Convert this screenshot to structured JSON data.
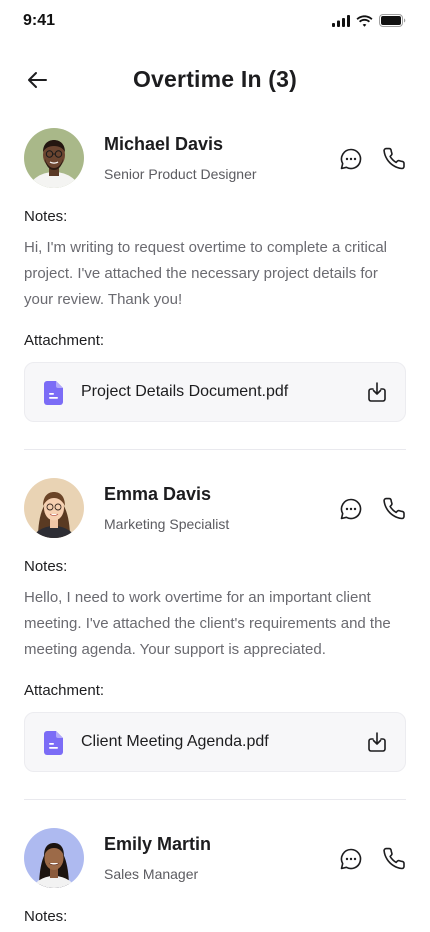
{
  "status_bar": {
    "time": "9:41"
  },
  "header": {
    "title": "Overtime In (3)"
  },
  "requests": [
    {
      "name": "Michael Davis",
      "role": "Senior Product Designer",
      "notes_label": "Notes:",
      "notes": "Hi, I'm writing to request overtime to complete a critical project. I've attached the necessary project details for your review. Thank you!",
      "attachment_label": "Attachment:",
      "attachment": "Project Details Document.pdf"
    },
    {
      "name": "Emma Davis",
      "role": "Marketing Specialist",
      "notes_label": "Notes:",
      "notes": "Hello, I need to work overtime for an important client meeting. I've attached the client's requirements and the meeting agenda. Your support is appreciated.",
      "attachment_label": "Attachment:",
      "attachment": "Client Meeting Agenda.pdf"
    },
    {
      "name": "Emily Martin",
      "role": "Sales Manager",
      "notes_label": "Notes:"
    }
  ],
  "colors": {
    "accent": "#7b6cf6",
    "text": "#1d1d1f",
    "muted": "#6a6a70"
  }
}
